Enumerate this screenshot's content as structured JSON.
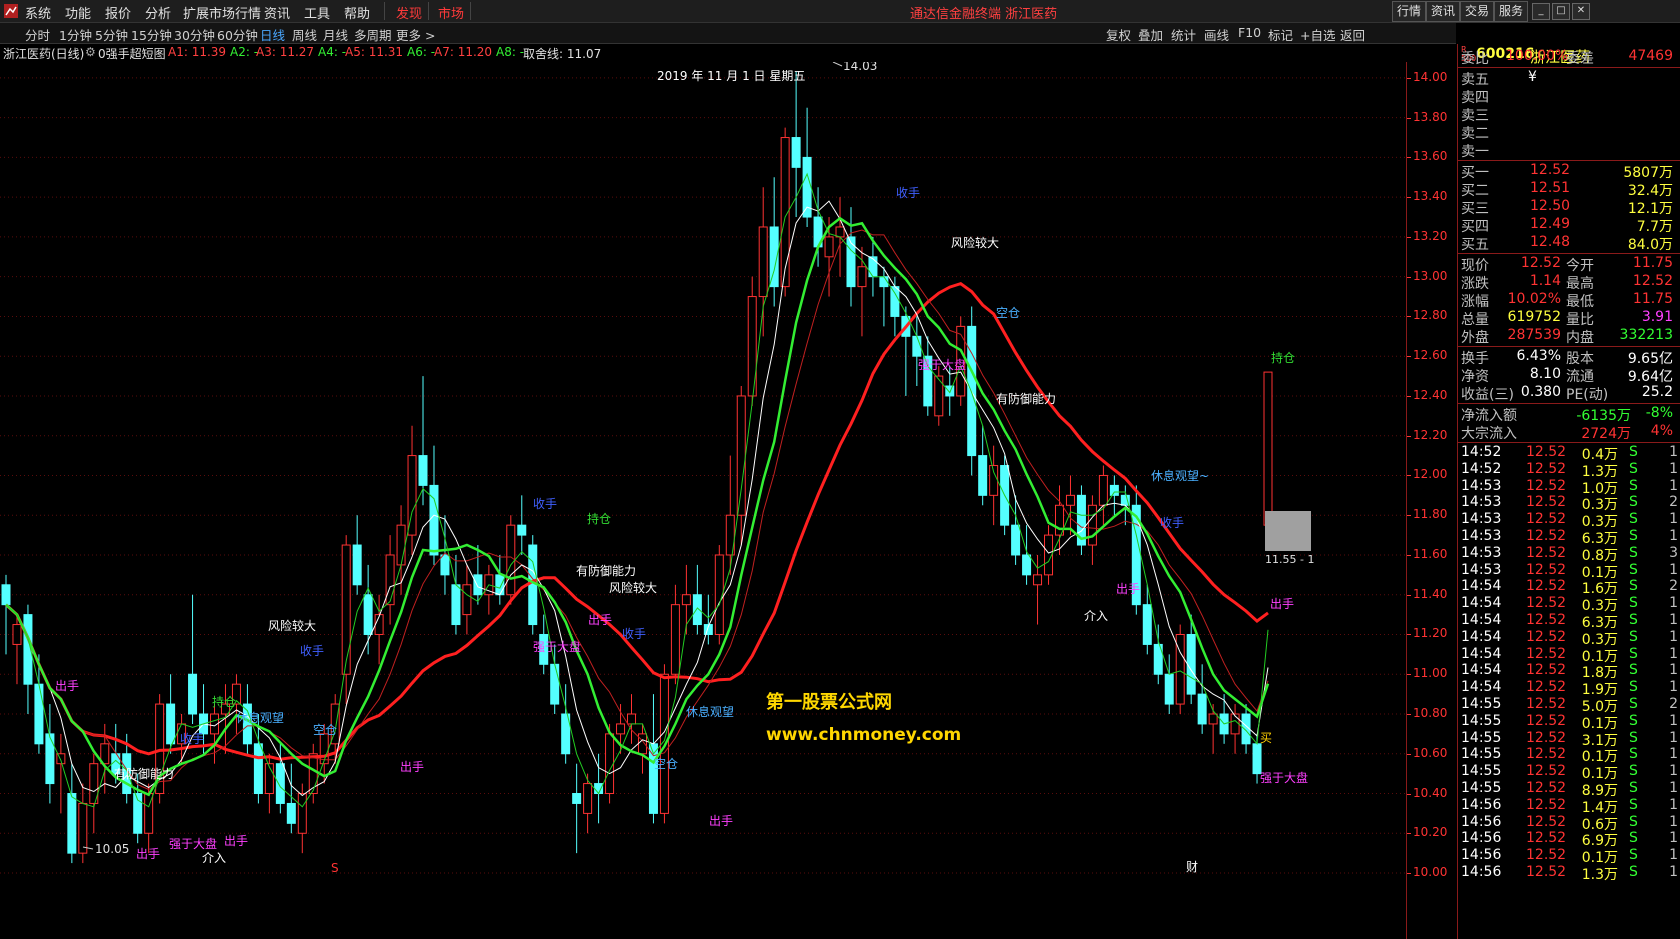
{
  "menu": {
    "items": [
      "系统",
      "功能",
      "报价",
      "分析",
      "扩展市场行情",
      "资讯",
      "工具",
      "帮助",
      "发现",
      "市场"
    ],
    "center_title": "通达信金融终端  浙江医药",
    "right_buttons": [
      "行情",
      "资讯",
      "交易",
      "服务"
    ],
    "window_buttons": [
      "_",
      "□",
      "✕"
    ]
  },
  "periods": [
    "分时",
    "1分钟",
    "5分钟",
    "15分钟",
    "30分钟",
    "60分钟",
    "日线",
    "周线",
    "月线",
    "多周期",
    "更多 >"
  ],
  "active_period": "日线",
  "tools": [
    "复权",
    "叠加",
    "统计",
    "画线",
    "F10",
    "标记",
    "+自选",
    "返回"
  ],
  "info": {
    "title": "浙江医药(日线)",
    "indicator": "0强手超短图",
    "a1": "A1: 11.39",
    "a2": "A2: -",
    "a3": "A3: 11.27",
    "a4": "A4: -",
    "a5": "A5: 11.31",
    "a6": "A6: -",
    "a7": "A7: 11.20",
    "a8": "A8: -",
    "quxian": "取舍线: 11.07"
  },
  "chart": {
    "date_label": "2019 年 11 月 1 日 星期五",
    "high_label": "14.03",
    "low_label": "10.05",
    "price_marker": "11.55 - 1",
    "watermark_title": "第一股票公式网",
    "watermark_url": "www.chnmoney.com",
    "y_ticks": [
      "14.00",
      "13.80",
      "13.60",
      "13.40",
      "13.20",
      "13.00",
      "12.80",
      "12.60",
      "12.40",
      "12.20",
      "12.00",
      "11.80",
      "11.60",
      "11.40",
      "11.20",
      "11.00",
      "10.80",
      "10.60",
      "10.40",
      "10.20",
      "10.00"
    ],
    "ylim": [
      9.98,
      14.08
    ],
    "colors": {
      "up": "#ff3232",
      "down": "#54ffff",
      "ma_red": "#ff2020",
      "ma_white": "#ffffff",
      "ma_green": "#33ee33"
    },
    "signals": [
      {
        "text": "风险较大",
        "color": "#ffffff",
        "x": 268,
        "y": 630
      },
      {
        "text": "收手",
        "color": "#4060ff",
        "x": 300,
        "y": 655
      },
      {
        "text": "出手",
        "color": "#ff40ff",
        "x": 55,
        "y": 690
      },
      {
        "text": "持仓",
        "color": "#33dd33",
        "x": 212,
        "y": 706
      },
      {
        "text": "休息观望",
        "color": "#4ab0ff",
        "x": 236,
        "y": 722
      },
      {
        "text": "空仓",
        "color": "#4ab0ff",
        "x": 313,
        "y": 734
      },
      {
        "text": "收手",
        "color": "#4060ff",
        "x": 180,
        "y": 743
      },
      {
        "text": "有防御能力",
        "color": "#ffffff",
        "x": 114,
        "y": 778
      },
      {
        "text": "出手",
        "color": "#ff40ff",
        "x": 136,
        "y": 858
      },
      {
        "text": "强于大盘",
        "color": "#ff40ff",
        "x": 169,
        "y": 848
      },
      {
        "text": "出手",
        "color": "#ff40ff",
        "x": 224,
        "y": 845
      },
      {
        "text": "介入",
        "color": "#ffffff",
        "x": 202,
        "y": 862
      },
      {
        "text": "出手",
        "color": "#ff40ff",
        "x": 400,
        "y": 771
      },
      {
        "text": "收手",
        "color": "#4060ff",
        "x": 533,
        "y": 508
      },
      {
        "text": "持仓",
        "color": "#33dd33",
        "x": 587,
        "y": 523
      },
      {
        "text": "有防御能力",
        "color": "#ffffff",
        "x": 576,
        "y": 575
      },
      {
        "text": "风险较大",
        "color": "#ffffff",
        "x": 609,
        "y": 592
      },
      {
        "text": "出手",
        "color": "#ff40ff",
        "x": 588,
        "y": 624
      },
      {
        "text": "收手",
        "color": "#4060ff",
        "x": 622,
        "y": 638
      },
      {
        "text": "强于大盘",
        "color": "#ff40ff",
        "x": 533,
        "y": 651
      },
      {
        "text": "空仓",
        "color": "#4ab0ff",
        "x": 654,
        "y": 768
      },
      {
        "text": "休息观望",
        "color": "#4ab0ff",
        "x": 686,
        "y": 716
      },
      {
        "text": "出手",
        "color": "#ff40ff",
        "x": 709,
        "y": 825
      },
      {
        "text": "收手",
        "color": "#4060ff",
        "x": 896,
        "y": 197
      },
      {
        "text": "风险较大",
        "color": "#ffffff",
        "x": 951,
        "y": 247
      },
      {
        "text": "空仓",
        "color": "#4ab0ff",
        "x": 996,
        "y": 317
      },
      {
        "text": "强于大盘",
        "color": "#ff40ff",
        "x": 918,
        "y": 369
      },
      {
        "text": "有防御能力",
        "color": "#ffffff",
        "x": 996,
        "y": 403
      },
      {
        "text": "休息观望~",
        "color": "#4ab0ff",
        "x": 1151,
        "y": 480
      },
      {
        "text": "收手",
        "color": "#4060ff",
        "x": 1160,
        "y": 527
      },
      {
        "text": "出手",
        "color": "#ff40ff",
        "x": 1116,
        "y": 593
      },
      {
        "text": "介入",
        "color": "#ffffff",
        "x": 1084,
        "y": 620
      },
      {
        "text": "持仓",
        "color": "#33dd33",
        "x": 1271,
        "y": 362
      },
      {
        "text": "出手",
        "color": "#ff40ff",
        "x": 1270,
        "y": 608
      },
      {
        "text": "买",
        "color": "#ffd000",
        "x": 1260,
        "y": 742
      },
      {
        "text": "强于大盘",
        "color": "#ff40ff",
        "x": 1260,
        "y": 782
      },
      {
        "text": "S",
        "color": "#ff3333",
        "x": 331,
        "y": 872
      },
      {
        "text": "财",
        "color": "#ffffff",
        "x": 1186,
        "y": 871
      }
    ]
  },
  "quote": {
    "code": "600216",
    "name": "浙江医药",
    "weibi_label": "委比",
    "weibi": "100.00%",
    "weicha_label": "委差",
    "weicha": "47469",
    "sell": [
      {
        "label": "卖五",
        "price": "¥",
        "vol": ""
      },
      {
        "label": "卖四",
        "price": "",
        "vol": ""
      },
      {
        "label": "卖三",
        "price": "",
        "vol": ""
      },
      {
        "label": "卖二",
        "price": "",
        "vol": ""
      },
      {
        "label": "卖一",
        "price": "",
        "vol": ""
      }
    ],
    "buy": [
      {
        "label": "买一",
        "price": "12.52",
        "vol": "5807万"
      },
      {
        "label": "买二",
        "price": "12.51",
        "vol": "32.4万"
      },
      {
        "label": "买三",
        "price": "12.50",
        "vol": "12.1万"
      },
      {
        "label": "买四",
        "price": "12.49",
        "vol": "7.7万"
      },
      {
        "label": "买五",
        "price": "12.48",
        "vol": "84.0万"
      }
    ],
    "stats": [
      {
        "l1": "现价",
        "v1": "12.52",
        "c1": "#ff3333",
        "l2": "今开",
        "v2": "11.75",
        "c2": "#ff3333"
      },
      {
        "l1": "涨跌",
        "v1": "1.14",
        "c1": "#ff3333",
        "l2": "最高",
        "v2": "12.52",
        "c2": "#ff3333"
      },
      {
        "l1": "涨幅",
        "v1": "10.02%",
        "c1": "#ff3333",
        "l2": "最低",
        "v2": "11.75",
        "c2": "#ff3333"
      },
      {
        "l1": "总量",
        "v1": "619752",
        "c1": "#ffff40",
        "l2": "量比",
        "v2": "3.91",
        "c2": "#ff40ff"
      },
      {
        "l1": "外盘",
        "v1": "287539",
        "c1": "#ff3333",
        "l2": "内盘",
        "v2": "332213",
        "c2": "#33ff33"
      }
    ],
    "stats2": [
      {
        "l1": "换手",
        "v1": "6.43%",
        "l2": "股本",
        "v2": "9.65亿"
      },
      {
        "l1": "净资",
        "v1": "8.10",
        "l2": "流通",
        "v2": "9.64亿"
      },
      {
        "l1": "收益(三)",
        "v1": "0.380",
        "l2": "PE(动)",
        "v2": "25.2"
      }
    ],
    "flow": [
      {
        "label": "净流入额",
        "value": "-6135万",
        "color": "#33ff33",
        "pct": "-8%",
        "pct_color": "#33ff33"
      },
      {
        "label": "大宗流入",
        "value": "2724万",
        "color": "#ff3333",
        "pct": "4%",
        "pct_color": "#ff3333"
      }
    ],
    "ticks": [
      [
        "14:52",
        "12.52",
        "0.4万",
        "S",
        "1"
      ],
      [
        "14:52",
        "12.52",
        "1.3万",
        "S",
        "1"
      ],
      [
        "14:53",
        "12.52",
        "1.0万",
        "S",
        "1"
      ],
      [
        "14:53",
        "12.52",
        "0.3万",
        "S",
        "2"
      ],
      [
        "14:53",
        "12.52",
        "0.3万",
        "S",
        "1"
      ],
      [
        "14:53",
        "12.52",
        "6.3万",
        "S",
        "1"
      ],
      [
        "14:53",
        "12.52",
        "0.8万",
        "S",
        "3"
      ],
      [
        "14:53",
        "12.52",
        "0.1万",
        "S",
        "1"
      ],
      [
        "14:54",
        "12.52",
        "1.6万",
        "S",
        "2"
      ],
      [
        "14:54",
        "12.52",
        "0.3万",
        "S",
        "1"
      ],
      [
        "14:54",
        "12.52",
        "6.3万",
        "S",
        "1"
      ],
      [
        "14:54",
        "12.52",
        "0.3万",
        "S",
        "1"
      ],
      [
        "14:54",
        "12.52",
        "0.1万",
        "S",
        "1"
      ],
      [
        "14:54",
        "12.52",
        "1.8万",
        "S",
        "1"
      ],
      [
        "14:54",
        "12.52",
        "1.9万",
        "S",
        "1"
      ],
      [
        "14:55",
        "12.52",
        "5.0万",
        "S",
        "2"
      ],
      [
        "14:55",
        "12.52",
        "0.1万",
        "S",
        "1"
      ],
      [
        "14:55",
        "12.52",
        "3.1万",
        "S",
        "1"
      ],
      [
        "14:55",
        "12.52",
        "0.1万",
        "S",
        "1"
      ],
      [
        "14:55",
        "12.52",
        "0.1万",
        "S",
        "1"
      ],
      [
        "14:55",
        "12.52",
        "8.9万",
        "S",
        "1"
      ],
      [
        "14:56",
        "12.52",
        "1.4万",
        "S",
        "1"
      ],
      [
        "14:56",
        "12.52",
        "0.6万",
        "S",
        "1"
      ],
      [
        "14:56",
        "12.52",
        "6.9万",
        "S",
        "1"
      ],
      [
        "14:56",
        "12.52",
        "0.1万",
        "S",
        "1"
      ],
      [
        "14:56",
        "12.52",
        "1.3万",
        "S",
        "1"
      ]
    ]
  }
}
